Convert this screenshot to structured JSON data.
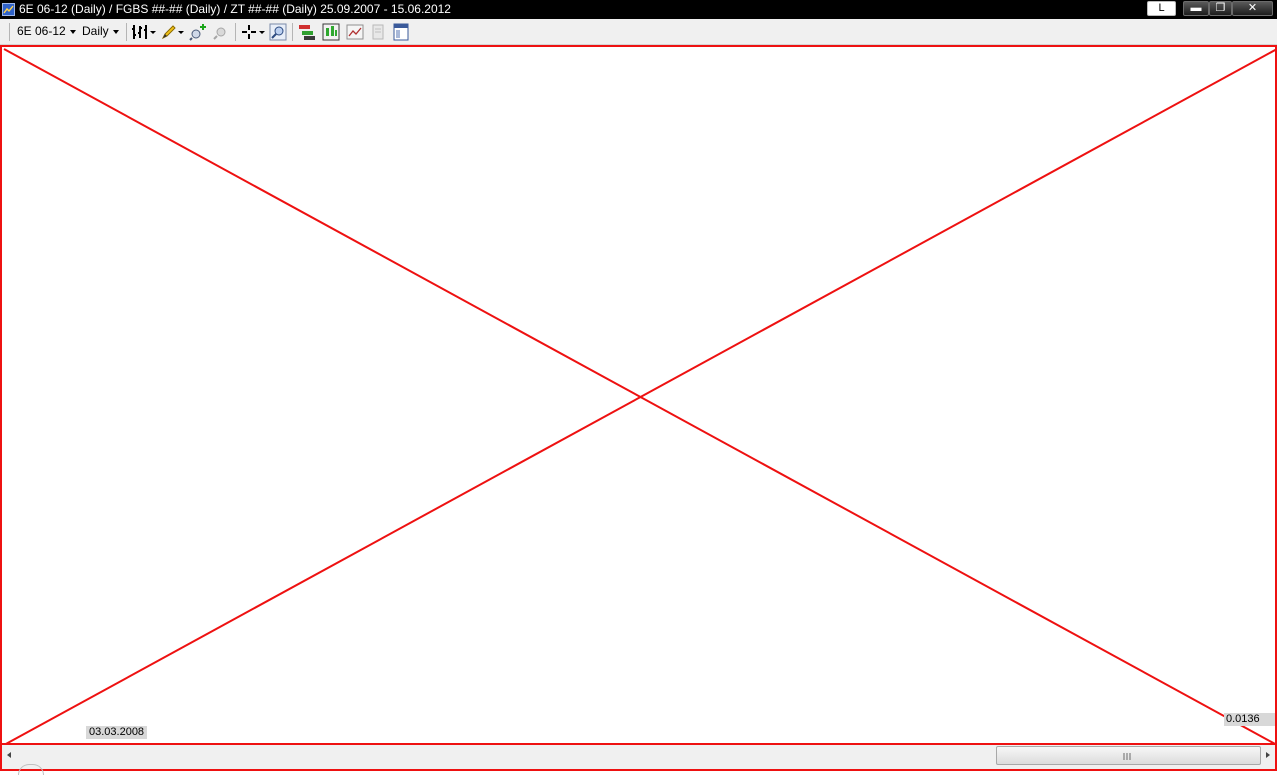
{
  "window": {
    "title": "6E 06-12 (Daily) / FGBS ##-## (Daily) / ZT ##-## (Daily)  25.09.2007 - 15.06.2012",
    "l_button": "L",
    "min_symbol": "▬",
    "max_symbol": "❐",
    "close_symbol": "✕"
  },
  "toolbar": {
    "instrument": "6E 06-12",
    "interval": "Daily"
  },
  "chart": {
    "date_label": "03.03.2008",
    "price_label": "0.0136",
    "error_line_color": "#ee1111"
  },
  "icons": {
    "bar-type": "bar-type-icon",
    "pencil": "pencil-icon",
    "add-indicator": "add-indicator-icon",
    "remove-indicator": "remove-indicator-icon",
    "crosshair": "crosshair-icon",
    "zoom": "zoom-icon",
    "strategies": "strategies-icon",
    "chart-trader": "chart-trader-icon",
    "data-box": "data-box-icon",
    "print": "print-icon",
    "properties": "properties-icon"
  }
}
